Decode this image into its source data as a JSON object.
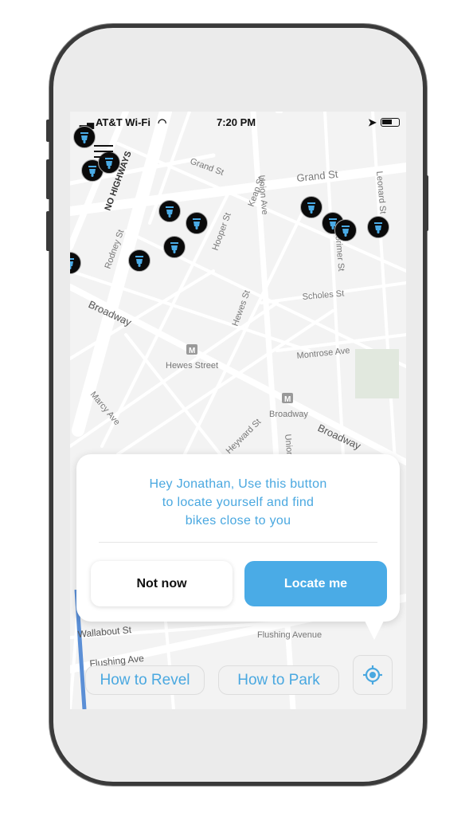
{
  "status_bar": {
    "carrier": "AT&T Wi-Fi",
    "time": "7:20 PM"
  },
  "map": {
    "streets": [
      "Grand St",
      "Grand St",
      "Keap St",
      "Union Ave",
      "Leonard St",
      "NO HIGHWAYS",
      "Rodney St",
      "Hooper St",
      "Lorimer St",
      "Scholes St",
      "Broadway",
      "Hewes St",
      "Montrose Ave",
      "Hewes Street",
      "Broadway",
      "Broadway",
      "Marcy Ave",
      "Heyward St",
      "Union Ave",
      "Wallabout St",
      "Flushing Avenue",
      "Flushing Ave"
    ],
    "marker_count": 12
  },
  "popup": {
    "message_lines": [
      "Hey Jonathan, Use this button",
      "to locate yourself and find",
      "bikes close to you"
    ],
    "not_now": "Not now",
    "locate_me": "Locate me"
  },
  "bottom": {
    "how_to_revel": "How to Revel",
    "how_to_park": "How to Park",
    "locate_icon": "crosshair-icon"
  },
  "colors": {
    "accent": "#4aabe6",
    "marker": "#0a0a0a",
    "map_bg": "#f3f3f3"
  }
}
